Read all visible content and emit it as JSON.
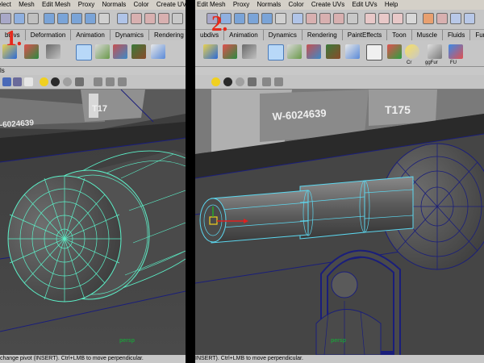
{
  "step_labels": [
    "1.",
    "2."
  ],
  "left": {
    "menu": [
      "elect",
      "Mesh",
      "Edit Mesh",
      "Proxy",
      "Normals",
      "Color",
      "Create UVs"
    ],
    "shelf_tabs": [
      "bdivs",
      "Deformation",
      "Animation",
      "Dynamics",
      "Rendering"
    ],
    "panel_menu_fragment": "ls",
    "viewport_label": "persp",
    "help_line": "change pivot (INSERT). Ctrl+LMB to move perpendicular."
  },
  "right": {
    "menu": [
      "Edit Mesh",
      "Proxy",
      "Normals",
      "Color",
      "Create UVs",
      "Edit UVs",
      "Help"
    ],
    "shelf_tabs": [
      "ubdivs",
      "Animation",
      "Dynamics",
      "Rendering",
      "PaintEffects",
      "Toon",
      "Muscle",
      "Fluids",
      "Fur"
    ],
    "shelf_labels": [
      "Cr",
      "ggFur",
      "FU"
    ],
    "viewport_label": "persp",
    "help_line": "INSERT). Ctrl+LMB to move perpendicular."
  },
  "scene_text": {
    "left_plate_line1": "T17",
    "left_plate_line2": "-6024639",
    "right_plate_line1": "T175",
    "right_plate_line2": "W-6024639"
  },
  "colors": {
    "wire_cyan": "#5cf0c8",
    "wire_blue": "#1a1e7a",
    "step_red": "#e62a1c",
    "persp_green": "#1f9a3c",
    "mesh_grey": "#5a5a5a"
  }
}
